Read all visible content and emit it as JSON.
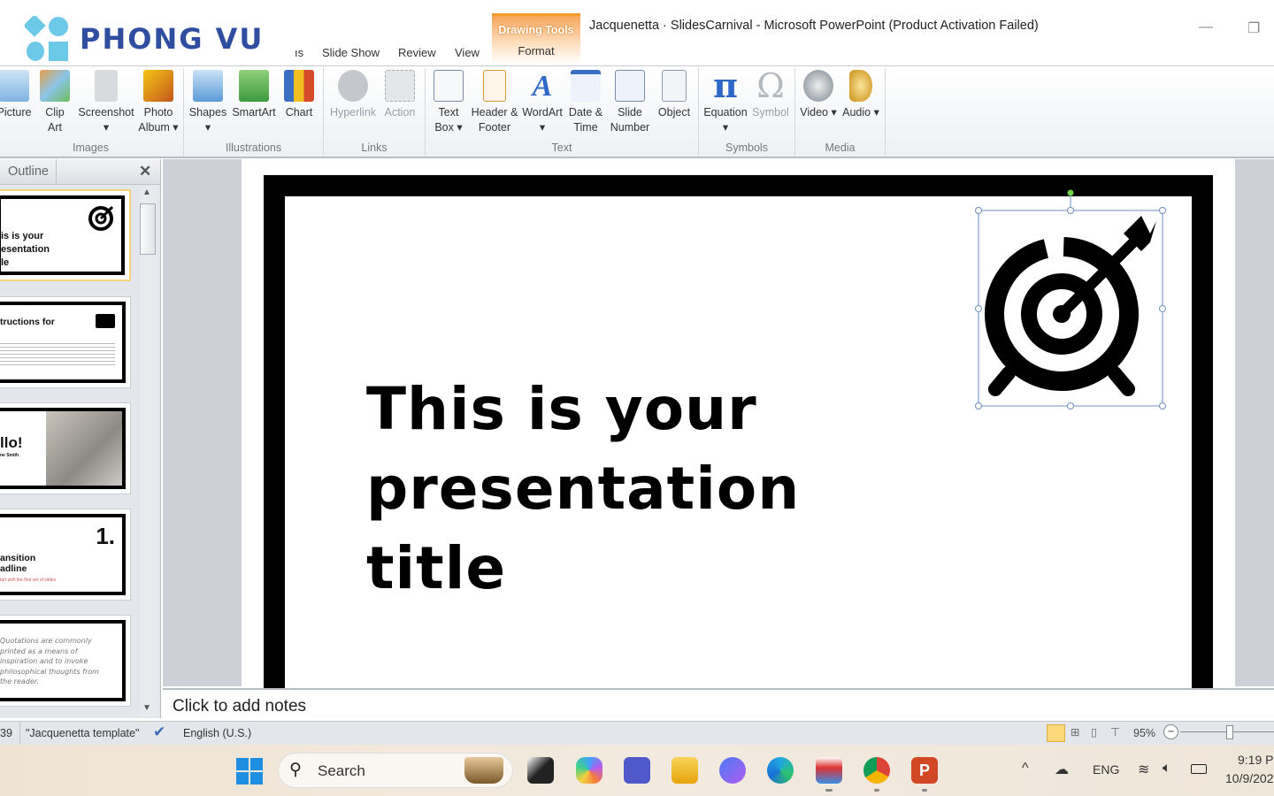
{
  "logo": {
    "text": "PHONG VU"
  },
  "window": {
    "title": "Jacquenetta · SlidesCarnival  -  Microsoft PowerPoint (Product Activation Failed)",
    "minimize": "—",
    "restore": "❐"
  },
  "tabs": [
    "ıs",
    "Slide Show",
    "Review",
    "View"
  ],
  "contextual": {
    "group": "Drawing Tools",
    "tab": "Format"
  },
  "ribbon": {
    "groups": [
      {
        "label": "Images",
        "buttons": [
          "Picture",
          "Clip Art",
          "Screenshot ▾",
          "Photo Album ▾"
        ]
      },
      {
        "label": "Illustrations",
        "buttons": [
          "Shapes ▾",
          "SmartArt",
          "Chart"
        ]
      },
      {
        "label": "Links",
        "buttons": [
          "Hyperlink",
          "Action"
        ]
      },
      {
        "label": "Text",
        "buttons": [
          "Text Box ▾",
          "Header & Footer",
          "WordArt ▾",
          "Date & Time",
          "Slide Number",
          "Object"
        ]
      },
      {
        "label": "Symbols",
        "buttons": [
          "Equation ▾",
          "Symbol"
        ]
      },
      {
        "label": "Media",
        "buttons": [
          "Video ▾",
          "Audio ▾"
        ]
      }
    ]
  },
  "left_pane": {
    "tab": "Outline",
    "close": "✕",
    "thumbs": [
      {
        "text": "is is your\nesentation\nle"
      },
      {
        "text": "tructions for"
      },
      {
        "text": "llo!",
        "sub": "ne Smith"
      },
      {
        "text": "ansition\nadline",
        "num": "1.",
        "sub": "tart with the first set of slides"
      },
      {
        "text": "Quotations are commonly printed as a means of inspiration and to invoke philosophical thoughts from the reader."
      }
    ]
  },
  "slide": {
    "title": "This is your presentation title"
  },
  "notes": {
    "placeholder": "Click to add notes"
  },
  "status": {
    "slide": "39",
    "theme": "\"Jacquenetta template\"",
    "language": "English (U.S.)",
    "zoom": "95%",
    "zoom_level": 0.95
  },
  "taskbar": {
    "search": "Search",
    "tray": {
      "lang": "ENG",
      "time": "9:19 P",
      "date": "10/9/202"
    }
  },
  "colors": {
    "accent": "#f39a2b",
    "logo": "#2f4ea0",
    "logo_shapes": "#6cc9e8"
  }
}
